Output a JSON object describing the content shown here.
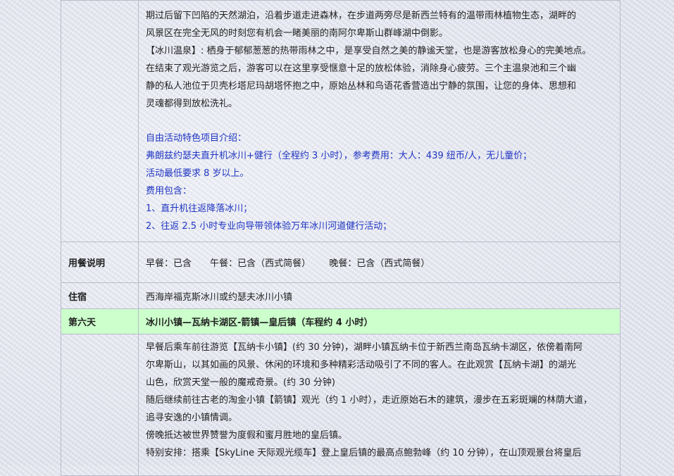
{
  "section1": {
    "lines": [
      "期过后留下凹陷的天然湖泊，沿着步道走进森林，在步道两旁尽是新西兰特有的温带雨林植物生态，湖畔的",
      "风景区在完全无风的时刻您有机会一睹美丽的南阿尔卑斯山群峰湖中倒影。",
      "【冰川温泉】: 栖身于郁郁葱葱的热带雨林之中，是享受自然之美的静谧天堂，也是游客放松身心的完美地点。",
      "在结束了观光游览之后，游客可以在这里享受惬意十足的放松体验，消除身心疲劳。三个主温泉池和三个幽",
      "静的私人池位于贝壳杉塔尼玛胡塔怀抱之中，原始丛林和鸟语花香营造出宁静的氛围，让您的身体、思想和",
      "灵魂都得到放松洗礼。"
    ],
    "optional": [
      "自由活动特色项目介绍：",
      "弗朗兹约瑟夫直升机冰川+健行（全程约 3 小时），参考费用：大人：439 纽币/人，无儿童价；",
      "活动最低要求 8 岁以上。",
      "费用包含：",
      "1、直升机往返降落冰川；",
      "2、往返 2.5 小时专业向导带领体验万年冰川河道健行活动；"
    ]
  },
  "meals": {
    "label": "用餐说明",
    "breakfast": "早餐：已含",
    "lunch": "午餐：已含（西式简餐）",
    "dinner": "晚餐：已含（西式简餐）"
  },
  "lodging": {
    "label": "住宿",
    "value": "西海岸福克斯冰川或约瑟夫冰川小镇"
  },
  "day6": {
    "label": "第六天",
    "title": "冰川小镇—瓦纳卡湖区-箭镇—皇后镇（车程约 4 小时）",
    "lines": [
      "早餐后乘车前往游览【瓦纳卡小镇】(约 30 分钟)，湖畔小镇瓦纳卡位于新西兰南岛瓦纳卡湖区，依傍着南阿",
      "尔卑斯山，以其如画的风景、休闲的环境和多种精彩活动吸引了不同的客人。在此观赏【瓦纳卡湖】的湖光",
      "山色，欣赏天堂一般的魔戒奇景。(约 30 分钟)",
      "随后继续前往古老的淘金小镇【箭镇】观光（约 1 小时），走近原始石木的建筑，漫步在五彩斑斓的林荫大道，",
      "追寻安逸的小镇情调。",
      "傍晚抵达被世界赞誉为度假和蜜月胜地的皇后镇。",
      "特别安排：搭乘【SkyLine 天际观光缆车】登上皇后镇的最高点鲍勃峰（约 10 分钟），在山顶观景台将皇后"
    ]
  }
}
